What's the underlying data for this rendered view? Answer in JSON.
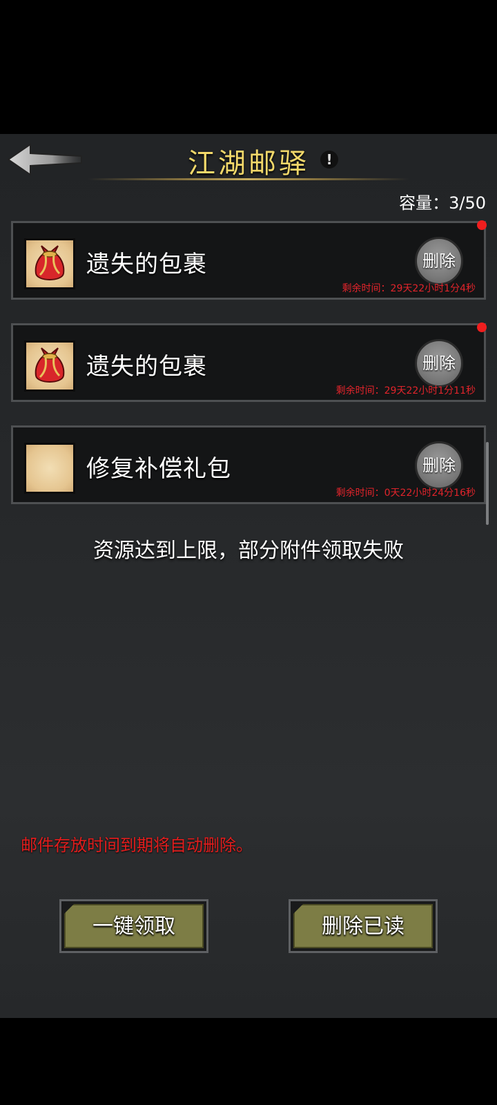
{
  "header": {
    "title": "江湖邮驿",
    "info_mark": "!",
    "capacity": "容量：3/50"
  },
  "mails": [
    {
      "title": "遗失的包裹",
      "delete_label": "删除",
      "remaining": "剩余时间：29天22小时1分4秒",
      "icon": "red-bag-icon",
      "unread": true
    },
    {
      "title": "遗失的包裹",
      "delete_label": "删除",
      "remaining": "剩余时间：29天22小时1分11秒",
      "icon": "red-bag-icon",
      "unread": true
    },
    {
      "title": "修复补偿礼包",
      "delete_label": "删除",
      "remaining": "剩余时间：0天22小时24分16秒",
      "icon": "parchment-icon",
      "unread": false
    }
  ],
  "toast": "资源达到上限，部分附件领取失败",
  "expire_note": "邮件存放时间到期将自动删除。",
  "actions": {
    "claim_all": "一键领取",
    "delete_read": "删除已读"
  },
  "colors": {
    "title": "#f2d86a",
    "warning": "#e11d1d",
    "button": "#7d7d45"
  }
}
